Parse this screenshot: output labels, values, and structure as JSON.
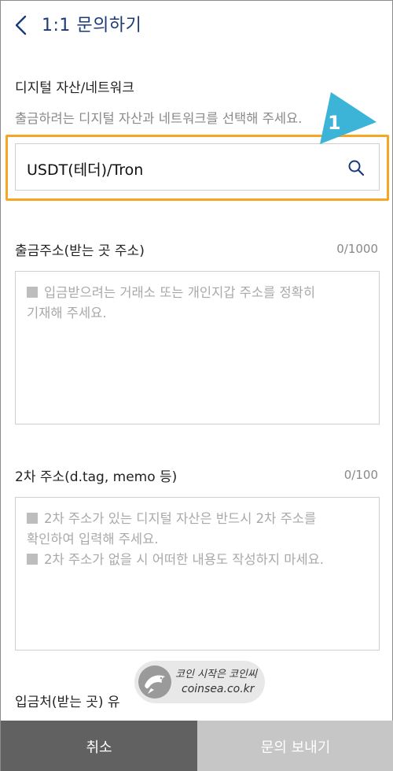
{
  "header": {
    "title": "1:1 문의하기",
    "back_icon": "chevron-left-icon"
  },
  "network": {
    "label": "디지털 자산/네트워크",
    "helper": "출금하려는 디지털 자산과 네트워크를 선택해 주세요.",
    "value": "USDT(테더)/Tron",
    "search_icon": "search-icon"
  },
  "annotation": {
    "step": "1",
    "highlight_color": "#f5a623",
    "pointer_color": "#3cb4d8"
  },
  "withdraw_address": {
    "label": "출금주소(받는 곳 주소)",
    "counter": "0/1000",
    "placeholder_line1": "입금받으려는 거래소 또는 개인지갑 주소를 정확히",
    "placeholder_line2": "기재해 주세요."
  },
  "secondary_address": {
    "label": "2차 주소(d.tag, memo 등)",
    "counter": "0/100",
    "placeholder_line1": "2차 주소가 있는 디지털 자산은 반드시 2차 주소를",
    "placeholder_line2": "확인하여 입력해 주세요.",
    "placeholder_line3": "2차 주소가 없을 시 어떠한 내용도 작성하지 마세요."
  },
  "deposit_type": {
    "label": "입금처(받는 곳) 유"
  },
  "watermark": {
    "line1": "코인 시작은 코인씨",
    "line2": "coinsea.co.kr"
  },
  "buttons": {
    "cancel": "취소",
    "send": "문의 보내기"
  },
  "colors": {
    "title": "#1b3a7a",
    "cancel_bg": "#616161",
    "send_bg": "#c6c6c6"
  }
}
